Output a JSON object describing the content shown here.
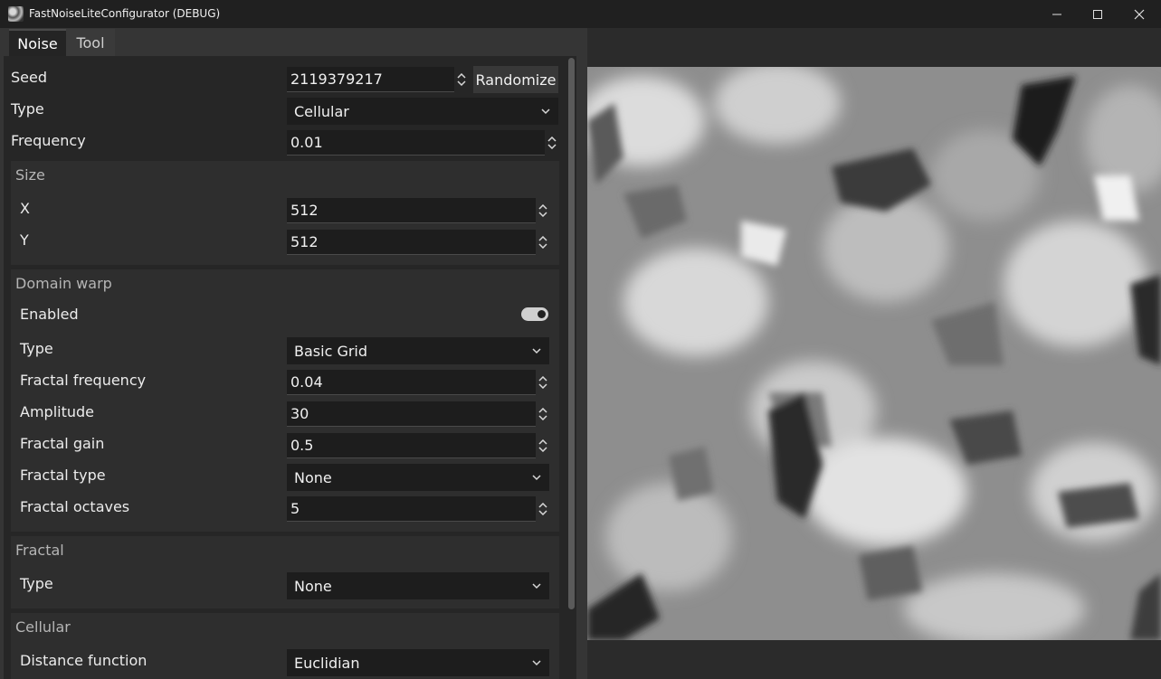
{
  "window": {
    "title": "FastNoiseLiteConfigurator (DEBUG)",
    "app_icon": "noise-app-icon",
    "controls": [
      "minimize-icon",
      "maximize-icon",
      "close-icon"
    ]
  },
  "tabs": [
    {
      "label": "Noise",
      "active": true
    },
    {
      "label": "Tool",
      "active": false
    }
  ],
  "noise": {
    "seed_label": "Seed",
    "seed_value": "2119379217",
    "randomize_label": "Randomize",
    "type_label": "Type",
    "type_value": "Cellular",
    "frequency_label": "Frequency",
    "frequency_value": "0.01"
  },
  "size": {
    "title": "Size",
    "x_label": "X",
    "x_value": "512",
    "y_label": "Y",
    "y_value": "512"
  },
  "domain_warp": {
    "title": "Domain warp",
    "enabled_label": "Enabled",
    "enabled": true,
    "type_label": "Type",
    "type_value": "Basic Grid",
    "fractal_frequency_label": "Fractal frequency",
    "fractal_frequency_value": "0.04",
    "amplitude_label": "Amplitude",
    "amplitude_value": "30",
    "fractal_gain_label": "Fractal gain",
    "fractal_gain_value": "0.5",
    "fractal_type_label": "Fractal type",
    "fractal_type_value": "None",
    "fractal_octaves_label": "Fractal octaves",
    "fractal_octaves_value": "5"
  },
  "fractal": {
    "title": "Fractal",
    "type_label": "Type",
    "type_value": "None"
  },
  "cellular": {
    "title": "Cellular",
    "distance_function_label": "Distance function",
    "distance_function_value": "Euclidian"
  },
  "colors": {
    "background": "#2b2b2b",
    "panel": "#262626",
    "group": "#2e2e2e",
    "field": "#1d1d1d",
    "text": "#ececec"
  }
}
